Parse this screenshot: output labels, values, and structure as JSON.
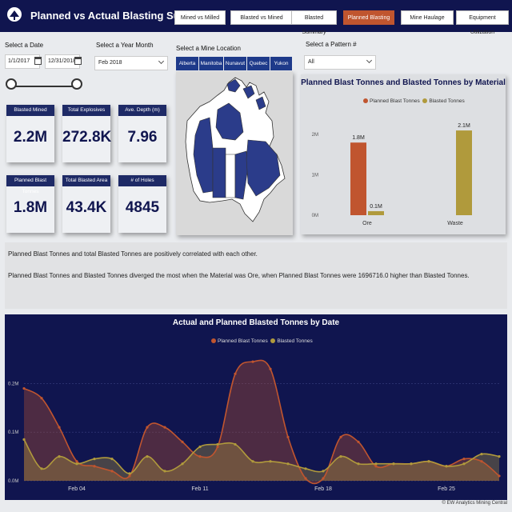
{
  "header": {
    "title": "Planned vs Actual Blasting Summary",
    "tabs": [
      {
        "label": "Mined vs Milled",
        "active": false
      },
      {
        "label": "Blasted vs Mined",
        "active": false
      },
      {
        "label": "Blasted Summary",
        "active": false
      },
      {
        "label": "Planned Blasting",
        "active": true
      },
      {
        "label": "Mine Haulage",
        "active": false
      },
      {
        "label": "Equipment Utilization",
        "active": false
      }
    ]
  },
  "filters": {
    "date_label": "Select a Date",
    "start_date": "1/1/2017",
    "end_date": "12/31/2018",
    "year_month_label": "Select a Year Month",
    "year_month_value": "Feb 2018",
    "mine_location_label": "Select a Mine Location",
    "locations": [
      "Alberta",
      "Manitoba",
      "Nunavut",
      "Quebec",
      "Yukon"
    ],
    "pattern_label": "Select a Pattern #",
    "pattern_value": "All"
  },
  "kpis": [
    {
      "title": "Blasted Mined",
      "value": "2.2M"
    },
    {
      "title": "Total Explosives",
      "value": "272.8K"
    },
    {
      "title": "Ave. Depth (m)",
      "value": "7.96"
    },
    {
      "title": "Planned Blast Tonnes",
      "value": "1.8M"
    },
    {
      "title": "Total Blasted Area",
      "value": "43.4K"
    },
    {
      "title": "# of Holes",
      "value": "4845"
    }
  ],
  "colors": {
    "planned": "#c0552f",
    "blasted": "#b09a3c",
    "navy": "#10154f"
  },
  "insights": [
    "Planned Blast Tonnes and total Blasted Tonnes are positively correlated with each other.",
    "Planned Blast Tonnes and Blasted Tonnes diverged the most when the Material was Ore, when Planned Blast Tonnes were 1696716.0 higher than Blasted Tonnes."
  ],
  "chart_data": [
    {
      "type": "bar",
      "title": "Planned Blast Tonnes and Blasted Tonnes by Material",
      "categories": [
        "Ore",
        "Waste"
      ],
      "series": [
        {
          "name": "Planned Blast Tonnes",
          "values": [
            1.8,
            0
          ]
        },
        {
          "name": "Blasted Tonnes",
          "values": [
            0.1,
            2.1
          ]
        }
      ],
      "data_labels": [
        [
          "1.8M",
          ""
        ],
        [
          "0.1M",
          "2.1M"
        ]
      ],
      "yticks": [
        "0M",
        "1M",
        "2M"
      ],
      "ylim": [
        0,
        2.3
      ],
      "legend": "top-center"
    },
    {
      "type": "area",
      "title": "Actual and Planned Blasted Tonnes by Date",
      "x": [
        "Feb 01",
        "Feb 02",
        "Feb 03",
        "Feb 04",
        "Feb 05",
        "Feb 06",
        "Feb 07",
        "Feb 08",
        "Feb 09",
        "Feb 10",
        "Feb 11",
        "Feb 12",
        "Feb 13",
        "Feb 14",
        "Feb 15",
        "Feb 16",
        "Feb 17",
        "Feb 18",
        "Feb 19",
        "Feb 20",
        "Feb 21",
        "Feb 22",
        "Feb 23",
        "Feb 24",
        "Feb 25",
        "Feb 26",
        "Feb 27",
        "Feb 28"
      ],
      "xticks": [
        "Feb 04",
        "Feb 11",
        "Feb 18",
        "Feb 25"
      ],
      "series": [
        {
          "name": "Planned Blast Tonnes",
          "values": [
            0.19,
            0.17,
            0.11,
            0.04,
            0.03,
            0.02,
            0.01,
            0.11,
            0.11,
            0.08,
            0.05,
            0.07,
            0.22,
            0.245,
            0.23,
            0.09,
            0.005,
            0.005,
            0.09,
            0.08,
            0.03,
            0.035,
            0.035,
            0.04,
            0.03,
            0.045,
            0.04,
            0.01
          ]
        },
        {
          "name": "Blasted Tonnes",
          "values": [
            0.085,
            0.025,
            0.05,
            0.035,
            0.045,
            0.045,
            0.015,
            0.05,
            0.02,
            0.035,
            0.07,
            0.075,
            0.075,
            0.04,
            0.04,
            0.035,
            0.025,
            0.02,
            0.05,
            0.035,
            0.035,
            0.035,
            0.035,
            0.04,
            0.03,
            0.035,
            0.055,
            0.05
          ]
        }
      ],
      "yticks": [
        "0.0M",
        "0.1M",
        "0.2M"
      ],
      "ylim": [
        0,
        0.26
      ],
      "legend": "top-center"
    }
  ],
  "footer": "© EW Analytics Mining Central"
}
